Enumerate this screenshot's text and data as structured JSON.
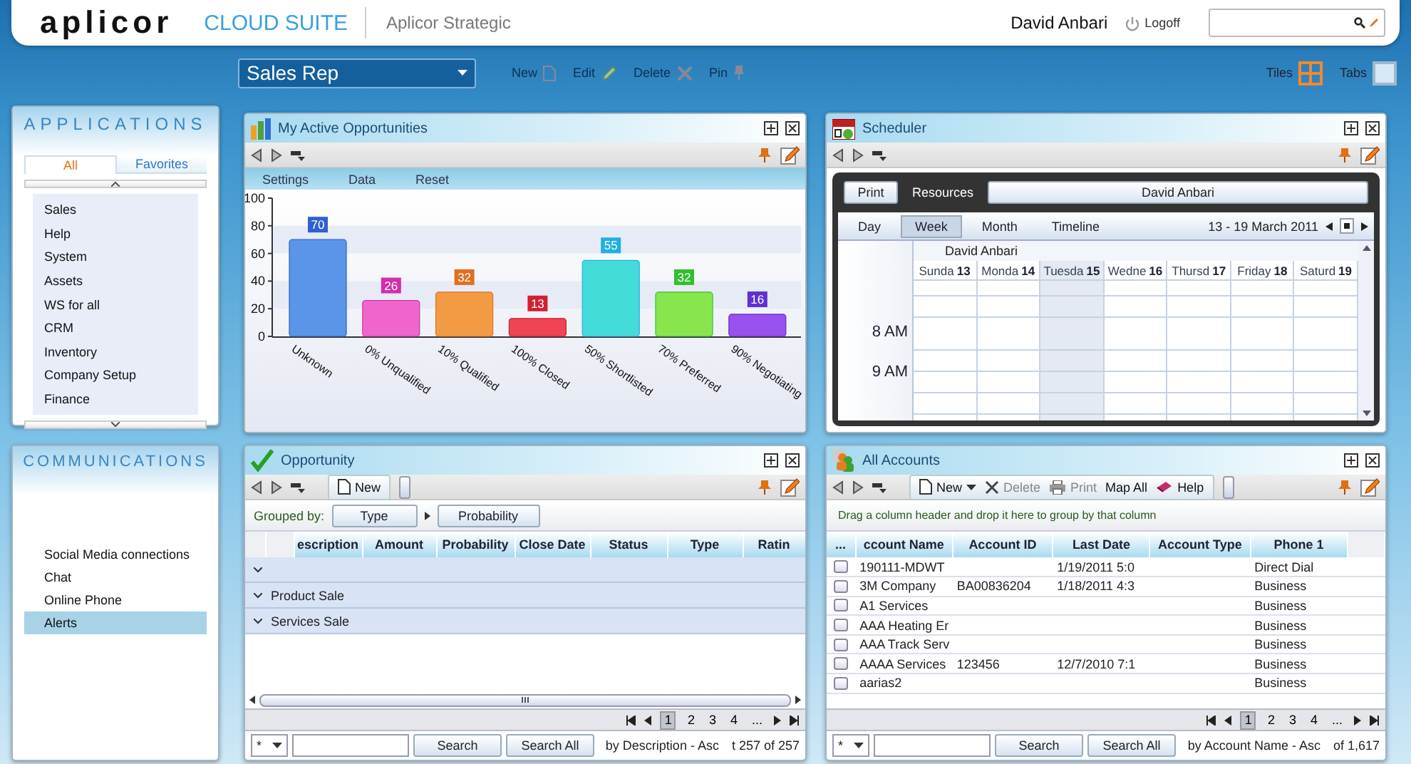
{
  "header": {
    "logo": "aplicor",
    "suite": "CLOUD SUITE",
    "company": "Aplicor Strategic",
    "user": "David Anbari",
    "logoff": "Logoff"
  },
  "toolbar": {
    "workspace": "Sales Rep",
    "actions": [
      {
        "label": "New",
        "kind": "new",
        "disabled": true
      },
      {
        "label": "Edit",
        "kind": "edit",
        "disabled": true
      },
      {
        "label": "Delete",
        "kind": "delete",
        "disabled": true
      },
      {
        "label": "Pin",
        "kind": "pin",
        "disabled": true
      }
    ],
    "views": [
      {
        "label": "Tiles",
        "kind": "tiles",
        "selected": true
      },
      {
        "label": "Tabs",
        "kind": "tabs",
        "selected": false
      }
    ]
  },
  "applications": {
    "title": "APPLICATIONS",
    "tabs": [
      {
        "label": "All",
        "selected": true
      },
      {
        "label": "Favorites",
        "selected": false
      }
    ],
    "items": [
      "Sales",
      "Help",
      "System",
      "Assets",
      "WS for all",
      "CRM",
      "Inventory",
      "Company Setup",
      "Finance"
    ]
  },
  "communications": {
    "title": "COMMUNICATIONS",
    "items": [
      {
        "label": "Social Media connections",
        "selected": false
      },
      {
        "label": "Chat",
        "selected": false
      },
      {
        "label": "Online Phone",
        "selected": false
      },
      {
        "label": "Alerts",
        "selected": true
      }
    ]
  },
  "opportunities_chart": {
    "title": "My Active Opportunities",
    "menu": [
      "Settings",
      "Data",
      "Reset"
    ],
    "chart_data": {
      "type": "bar",
      "categories": [
        "Unknown",
        "0% Unqualified",
        "10% Qualified",
        "100% Closed",
        "50% Shortlisted",
        "70% Preferred",
        "90% Negotiating"
      ],
      "values": [
        70,
        26,
        32,
        13,
        55,
        32,
        16
      ],
      "ylim": [
        0,
        100
      ],
      "yticks": [
        0,
        20,
        40,
        60,
        80,
        100
      ],
      "data_labels": true
    }
  },
  "scheduler": {
    "title": "Scheduler",
    "print": "Print",
    "resources_label": "Resources",
    "resource": "David Anbari",
    "views": [
      {
        "label": "Day",
        "selected": false
      },
      {
        "label": "Week",
        "selected": true
      },
      {
        "label": "Month",
        "selected": false
      },
      {
        "label": "Timeline",
        "selected": false
      }
    ],
    "range": "13 - 19 March 2011",
    "resource_header": "David Anbari",
    "days": [
      {
        "name": "Sunda",
        "date": "13",
        "today": false
      },
      {
        "name": "Monda",
        "date": "14",
        "today": false
      },
      {
        "name": "Tuesda",
        "date": "15",
        "today": true
      },
      {
        "name": "Wedne",
        "date": "16",
        "today": false
      },
      {
        "name": "Thursd",
        "date": "17",
        "today": false
      },
      {
        "name": "Friday",
        "date": "18",
        "today": false
      },
      {
        "name": "Saturd",
        "date": "19",
        "today": false
      }
    ],
    "times": [
      "8 AM",
      "9 AM"
    ]
  },
  "opportunity_grid": {
    "title": "Opportunity",
    "toolbar": [
      {
        "label": "New",
        "kind": "new",
        "disabled": false
      }
    ],
    "grouped_by_label": "Grouped by:",
    "groups": [
      "Type",
      "Probability"
    ],
    "columns": [
      "escription",
      "Amount",
      "Probability",
      "Close Date",
      "Status",
      "Type",
      "Ratin"
    ],
    "group_rows": [
      {
        "kind": "blank"
      },
      {
        "kind": "group",
        "label": "Product Sale"
      },
      {
        "kind": "group",
        "label": "Services Sale"
      }
    ],
    "pages": [
      {
        "label": "1",
        "selected": true
      },
      {
        "label": "2",
        "selected": false
      },
      {
        "label": "3",
        "selected": false
      },
      {
        "label": "4",
        "selected": false
      },
      {
        "label": "...",
        "selected": false
      }
    ],
    "filter": "*",
    "search": "Search",
    "search_all": "Search All",
    "sort": "by Description - Asc",
    "count": "t 257 of 257"
  },
  "accounts_grid": {
    "title": "All Accounts",
    "toolbar": [
      {
        "label": "New",
        "kind": "new",
        "disabled": false
      },
      {
        "label": "Delete",
        "kind": "delete",
        "disabled": true
      },
      {
        "label": "Print",
        "kind": "print",
        "disabled": true
      },
      {
        "label": "Map All",
        "kind": "map",
        "disabled": false
      },
      {
        "label": "Help",
        "kind": "help",
        "disabled": false
      }
    ],
    "hint": "Drag a column header and drop it here to group by that column",
    "select_header": "...",
    "columns": [
      "ccount Name",
      "Account ID",
      "Last Date",
      "Account Type",
      "Phone 1"
    ],
    "rows": [
      {
        "checked": false,
        "cells": [
          "190111-MDWT",
          "",
          "1/19/2011 5:0",
          "",
          "Direct Dial"
        ]
      },
      {
        "checked": false,
        "cells": [
          "3M Company",
          "BA00836204",
          "1/18/2011 4:3",
          "",
          "Business"
        ]
      },
      {
        "checked": false,
        "cells": [
          "A1 Services",
          "",
          "",
          "",
          "Business"
        ]
      },
      {
        "checked": false,
        "cells": [
          "AAA Heating Er",
          "",
          "",
          "",
          "Business"
        ]
      },
      {
        "checked": false,
        "cells": [
          "AAA Track Serv",
          "",
          "",
          "",
          "Business"
        ]
      },
      {
        "checked": false,
        "cells": [
          "AAAA Services",
          "123456",
          "12/7/2010 7:1",
          "",
          "Business"
        ]
      },
      {
        "checked": false,
        "cells": [
          "aarias2",
          "",
          "",
          "",
          "Business"
        ]
      }
    ],
    "pages": [
      {
        "label": "1",
        "selected": true
      },
      {
        "label": "2",
        "selected": false
      },
      {
        "label": "3",
        "selected": false
      },
      {
        "label": "4",
        "selected": false
      },
      {
        "label": "...",
        "selected": false
      }
    ],
    "filter": "*",
    "search": "Search",
    "search_all": "Search All",
    "sort": "by Account Name - Asc",
    "count": "of 1,617"
  }
}
